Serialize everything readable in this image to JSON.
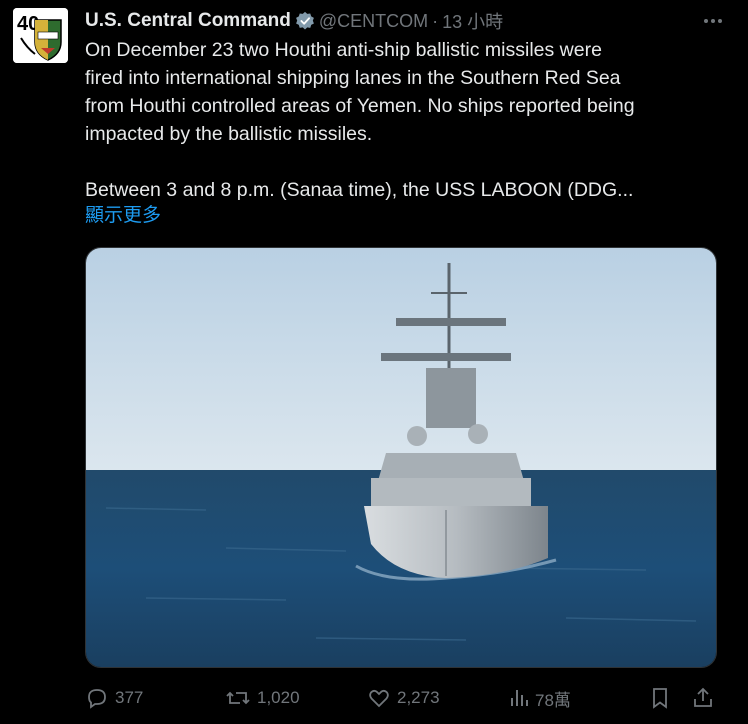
{
  "tweet": {
    "author_name": "U.S. Central Command",
    "handle": "@CENTCOM",
    "separator": "·",
    "time": "13 小時",
    "paragraph1": "On December 23 two Houthi anti-ship ballistic missiles were\nfired into international shipping lanes in the Southern Red Sea\nfrom Houthi controlled areas of Yemen. No ships reported being\nimpacted by the ballistic missiles.",
    "paragraph2": "Between 3 and 8 p.m. (Sanaa time), the USS LABOON (DDG...",
    "show_more": "顯示更多"
  },
  "avatar": {
    "badge_text": "40"
  },
  "actions": {
    "replies": "377",
    "reposts": "1,020",
    "likes": "2,273",
    "views": "78萬"
  },
  "colors": {
    "background": "#000000",
    "text": "#e7e9ea",
    "muted": "#71767b",
    "link": "#1d9bf0",
    "verified": "#829aab"
  },
  "icons": [
    "verified-badge-icon",
    "more-icon",
    "reply-icon",
    "repost-icon",
    "like-icon",
    "views-icon",
    "bookmark-icon",
    "share-icon"
  ],
  "media": {
    "description_kind": "photo"
  }
}
